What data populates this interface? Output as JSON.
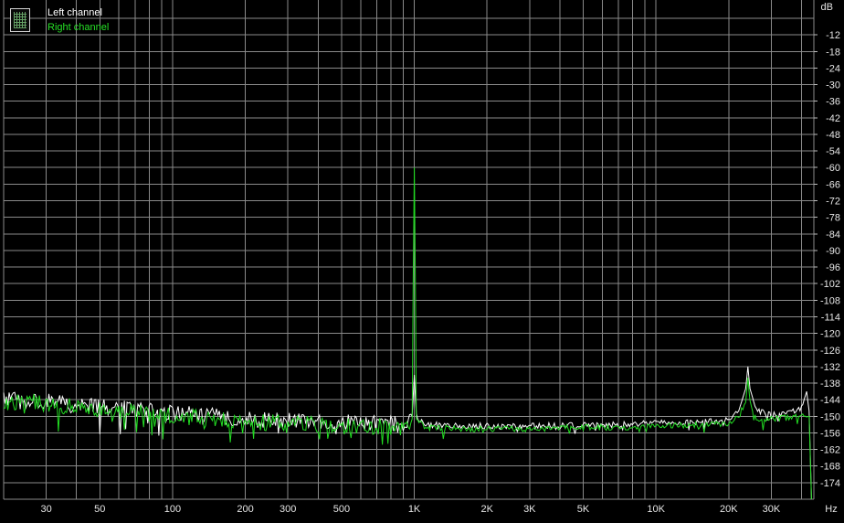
{
  "chart_data": {
    "type": "line",
    "xscale": "log",
    "xlim": [
      20,
      45000
    ],
    "ylim": [
      -180,
      -6
    ],
    "ylabel": "dB",
    "xlabel": "Hz",
    "y_ticks": [
      -12,
      -18,
      -24,
      -30,
      -36,
      -42,
      -48,
      -54,
      -60,
      -66,
      -72,
      -78,
      -84,
      -90,
      -96,
      -102,
      -108,
      -114,
      -120,
      -126,
      -132,
      -138,
      -144,
      -150,
      -156,
      -162,
      -168,
      -174
    ],
    "x_ticks": [
      {
        "value": 30,
        "label": "30"
      },
      {
        "value": 50,
        "label": "50"
      },
      {
        "value": 100,
        "label": "100"
      },
      {
        "value": 200,
        "label": "200"
      },
      {
        "value": 300,
        "label": "300"
      },
      {
        "value": 500,
        "label": "500"
      },
      {
        "value": 1000,
        "label": "1K"
      },
      {
        "value": 2000,
        "label": "2K"
      },
      {
        "value": 3000,
        "label": "3K"
      },
      {
        "value": 5000,
        "label": "5K"
      },
      {
        "value": 10000,
        "label": "10K"
      },
      {
        "value": 20000,
        "label": "20K"
      },
      {
        "value": 30000,
        "label": "30K"
      }
    ],
    "grid": true,
    "legend_position": "top-left",
    "series": [
      {
        "name": "Left channel",
        "color": "#ffffff",
        "points": [
          [
            20,
            -143.5
          ],
          [
            25,
            -145
          ],
          [
            30,
            -144
          ],
          [
            35,
            -145.5
          ],
          [
            40,
            -146
          ],
          [
            50,
            -146.5
          ],
          [
            60,
            -147
          ],
          [
            70,
            -147
          ],
          [
            80,
            -148
          ],
          [
            100,
            -149
          ],
          [
            150,
            -150
          ],
          [
            200,
            -151
          ],
          [
            300,
            -151.5
          ],
          [
            500,
            -152
          ],
          [
            700,
            -152.5
          ],
          [
            900,
            -153
          ],
          [
            980,
            -150
          ],
          [
            1000,
            -135
          ],
          [
            1020,
            -150
          ],
          [
            1100,
            -153
          ],
          [
            1500,
            -153.5
          ],
          [
            2000,
            -153.5
          ],
          [
            3000,
            -153.5
          ],
          [
            5000,
            -153
          ],
          [
            7000,
            -153
          ],
          [
            10000,
            -152.5
          ],
          [
            15000,
            -152
          ],
          [
            20000,
            -151.5
          ],
          [
            22000,
            -148
          ],
          [
            23500,
            -140
          ],
          [
            24000,
            -132
          ],
          [
            24500,
            -140
          ],
          [
            26000,
            -148
          ],
          [
            30000,
            -149.5
          ],
          [
            35000,
            -149
          ],
          [
            40000,
            -147
          ],
          [
            42000,
            -141
          ],
          [
            43000,
            -148
          ],
          [
            44000,
            -180
          ]
        ]
      },
      {
        "name": "Right channel",
        "color": "#22dd22",
        "points": [
          [
            20,
            -145
          ],
          [
            25,
            -144.5
          ],
          [
            30,
            -145.5
          ],
          [
            35,
            -146.5
          ],
          [
            40,
            -146.5
          ],
          [
            50,
            -147.5
          ],
          [
            60,
            -148
          ],
          [
            70,
            -148.5
          ],
          [
            80,
            -149
          ],
          [
            100,
            -150
          ],
          [
            150,
            -151
          ],
          [
            200,
            -152
          ],
          [
            300,
            -152.5
          ],
          [
            500,
            -153
          ],
          [
            700,
            -153.5
          ],
          [
            900,
            -154
          ],
          [
            980,
            -151
          ],
          [
            990,
            -100
          ],
          [
            1000,
            -60
          ],
          [
            1010,
            -100
          ],
          [
            1020,
            -151
          ],
          [
            1100,
            -154
          ],
          [
            1500,
            -154.5
          ],
          [
            2000,
            -154.5
          ],
          [
            3000,
            -154.5
          ],
          [
            5000,
            -154
          ],
          [
            7000,
            -154
          ],
          [
            10000,
            -153.5
          ],
          [
            15000,
            -153
          ],
          [
            20000,
            -152.5
          ],
          [
            22000,
            -150
          ],
          [
            23500,
            -145
          ],
          [
            24000,
            -136
          ],
          [
            24500,
            -145
          ],
          [
            26000,
            -151
          ],
          [
            30000,
            -151
          ],
          [
            35000,
            -150.5
          ],
          [
            40000,
            -150
          ],
          [
            43000,
            -150
          ],
          [
            44000,
            -180
          ]
        ]
      }
    ]
  },
  "legend": {
    "left_label": "Left channel",
    "right_label": "Right channel"
  }
}
